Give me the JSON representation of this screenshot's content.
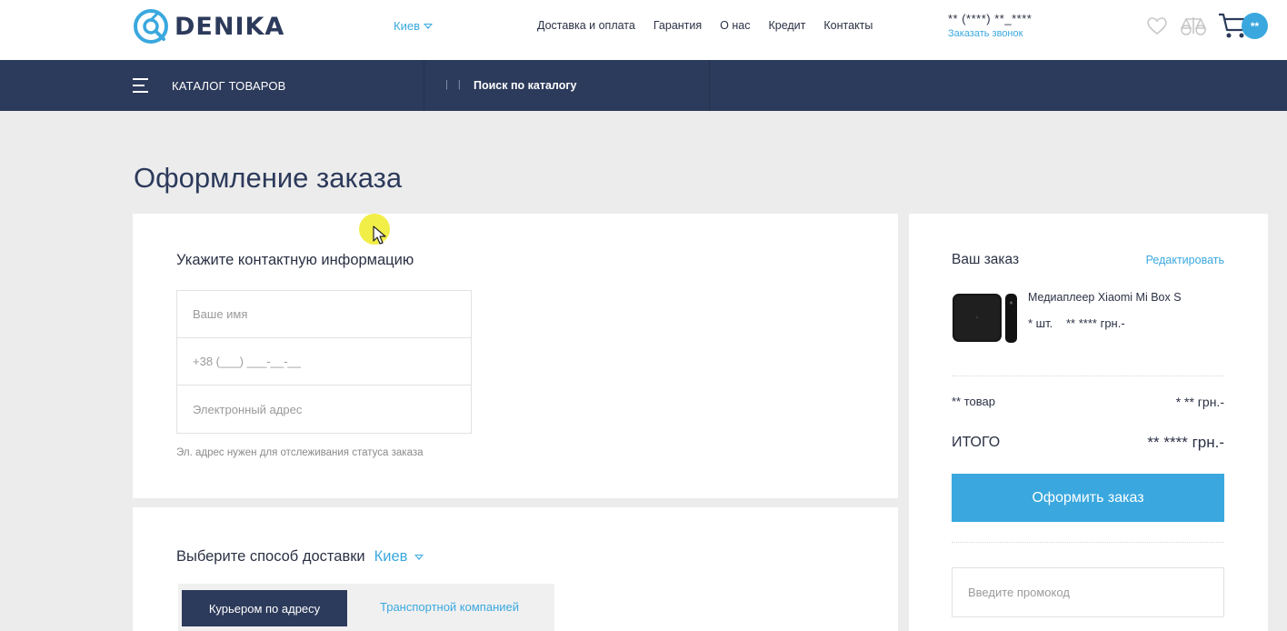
{
  "header": {
    "logo_text": "DENIKA",
    "city": "Киев",
    "nav": [
      "Доставка и оплата",
      "Гарантия",
      "О нас",
      "Кредит",
      "Контакты"
    ],
    "phone": "** (****) **_****",
    "callback": "Заказать звонок",
    "cart_count": "**"
  },
  "catalog_bar": {
    "catalog_label": "КАТАЛОГ ТОВАРОВ",
    "search_pipes": "| |",
    "search_label": "Поиск по каталогу"
  },
  "page": {
    "title": "Оформление заказа"
  },
  "contact": {
    "title": "Укажите контактную информацию",
    "name_placeholder": "Ваше имя",
    "phone_placeholder": "+38 (___) ___-__-__",
    "email_placeholder": "Электронный адрес",
    "hint": "Эл. адрес нужен для отслеживания статуса заказа"
  },
  "delivery": {
    "title": "Выберите способ доставки",
    "city": "Киев",
    "tab_courier": "Курьером по адресу",
    "tab_transport": "Транспортной компанией"
  },
  "order": {
    "title": "Ваш заказ",
    "edit": "Редактировать",
    "product_name": "Медиаплеер Xiaomi Mi Box S",
    "product_qty": "* шт.",
    "product_price": "** **** грн.-",
    "items_label": "** товар",
    "items_value": "* ** грн.-",
    "total_label": "ИТОГО",
    "total_value": "** **** грн.-",
    "checkout": "Оформить заказ",
    "promo_placeholder": "Введите промокод"
  },
  "colors": {
    "accent": "#3aa8df",
    "navy": "#2c3a5b",
    "background": "#ececec"
  },
  "icons": [
    "logo-mark-icon",
    "chevron-down-icon",
    "heart-icon",
    "compare-icon",
    "cart-icon",
    "menu-icon",
    "mouse-cursor-icon"
  ]
}
